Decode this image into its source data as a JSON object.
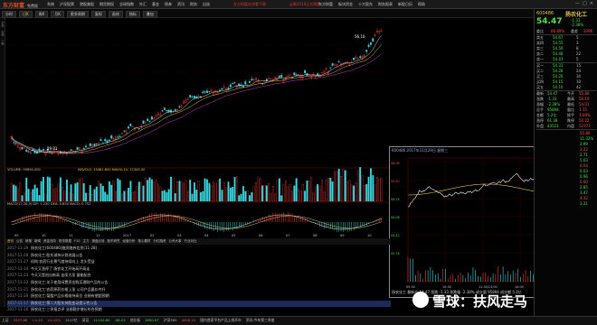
{
  "app": {
    "logo": "东方财富",
    "logo_sub": "免费版",
    "menu": [
      "系统",
      "沪深股票",
      "港股美股",
      "期货期权",
      "全球指数",
      "外汇",
      "基金",
      "债券",
      "资讯",
      "财务",
      "自选"
    ],
    "ad1": "东方财富在线看下载",
    "ad2": "云聚2018正式揭牌",
    "top_right": [
      "东方财富",
      "板块资金",
      "十大股东",
      "财务报表",
      "新股日历",
      "帮助"
    ],
    "win_controls": [
      "—",
      "□",
      "×"
    ]
  },
  "toolbar": {
    "tabs": [
      "分时",
      "日K",
      "周K",
      "月K",
      "更多周期",
      "复权",
      "画线",
      "指标",
      "叠加"
    ],
    "active_index": 1
  },
  "chart": {
    "title": "扬农化工 (日线 前复权)",
    "high_label": "56.10",
    "low_label": "29.01",
    "volume_label": "VOLUME: 95894.000",
    "volume_extra": "MAVOL5: 15481.600  MAVOL10: 12345.00",
    "macd_label": "MACD(12,26,9)  DIF: 1.230  DEA: 0.854  MACD: 0.752",
    "x_ticks": [
      "09",
      "10",
      "11",
      "12",
      "2017",
      "02",
      "03",
      "04",
      "05",
      "06",
      "07",
      "08",
      "09",
      "10"
    ],
    "left_labels": [
      "沪深",
      "行情",
      "个股"
    ]
  },
  "popup": {
    "title": "600486 2017年11月29日 星期三",
    "footer": "扬农化工 最新价 54.47 涨跌 -1.33 涨跌幅 -2.38% 成交量 95894 成交额 5.2亿",
    "y_labels_left": [
      "56.06",
      "55.40",
      "54.74",
      "54.08",
      "53.42",
      "52.76"
    ],
    "y_labels_right": [
      "4.59%",
      "3.00%",
      "1.71%",
      "0.31%",
      "-1.02%",
      "-2.38%"
    ],
    "x_labels": [
      "09:30",
      "10:30",
      "11:30/13:00",
      "14:00",
      "15:00"
    ]
  },
  "bottom": {
    "tabs": [
      "资讯",
      "公告",
      "研报",
      "新闻",
      "资金流向",
      "财务数据",
      "F10",
      "主力",
      "操盘必读",
      "股东研究",
      "经营分析",
      "核心题材",
      "分红融资",
      "公司大事",
      "行业对比"
    ],
    "active_index": 0
  },
  "news": [
    {
      "date": "2017-11-29",
      "title": "扬农化工(600486)融资融券信息(11-28)"
    },
    {
      "date": "2017-11-28",
      "title": "扬农化工:股东减持计划进展公告"
    },
    {
      "date": "2017-11-27",
      "title": "机构:农药行业景气度持续向上 龙头受益"
    },
    {
      "date": "2017-11-24",
      "title": "今天又涨停了 扬农化工开始高开高走"
    },
    {
      "date": "2017-11-23",
      "title": "今天又是创出新高 连续大涨 量能配合"
    },
    {
      "date": "2017-11-22",
      "title": "扬农化工:关于使用闲置资金购买理财产品的公告"
    },
    {
      "date": "2017-11-21",
      "title": "扬农化工:农药原药价格上涨 公司产品量价齐升"
    },
    {
      "date": "2017-11-20",
      "title": "扬农化工:菊酯产品价格维持高位 业绩有望超预期"
    },
    {
      "date": "2017-11-17",
      "title": "扬农化工:第二大股东持股变动提示性公告"
    },
    {
      "date": "2017-11-16",
      "title": "扬农化工:三季报点评 业绩稳步增长符合预期"
    }
  ],
  "news_selected_index": 8,
  "right_panel": {
    "code": "600486",
    "name": "扬农化工",
    "price": "54.47",
    "change": "-1.33",
    "change_pct": "-2.38%",
    "ratio_label": "委比",
    "ratio": "66.89%",
    "diff_label": "委差",
    "diff": "1096",
    "sell": [
      {
        "l": "卖五",
        "p": "54.67",
        "v": "5"
      },
      {
        "l": "卖四",
        "p": "54.55",
        "v": "3"
      },
      {
        "l": "卖三",
        "p": "54.50",
        "v": "8"
      },
      {
        "l": "卖二",
        "p": "54.48",
        "v": "22"
      },
      {
        "l": "卖一",
        "p": "54.47",
        "v": "5"
      }
    ],
    "buy": [
      {
        "l": "买一",
        "p": "54.31",
        "v": "15"
      },
      {
        "l": "买二",
        "p": "54.28",
        "v": "24"
      },
      {
        "l": "买三",
        "p": "54.20",
        "v": "34"
      },
      {
        "l": "买四",
        "p": "54.15",
        "v": "10"
      },
      {
        "l": "买五",
        "p": "54.10",
        "v": "42"
      }
    ],
    "stats": [
      {
        "l": "最新",
        "v": "54.47",
        "l2": "今开",
        "v2": "55.80"
      },
      {
        "l": "涨跌",
        "v": "-1.33",
        "l2": "最高",
        "v2": "56.10"
      },
      {
        "l": "涨幅",
        "v": "-2.38%",
        "l2": "最低",
        "v2": "54.01"
      },
      {
        "l": "总手",
        "v": "95894",
        "l2": "量比",
        "v2": "1.15"
      },
      {
        "l": "金额",
        "v": "5.2亿",
        "l2": "换手",
        "v2": "3.09%"
      },
      {
        "l": "涨停",
        "v": "61.38",
        "l2": "跌停",
        "v2": "50.22"
      },
      {
        "l": "外盘",
        "v": "43521",
        "l2": "内盘",
        "v2": "52373"
      }
    ],
    "side_values": [
      "55.80",
      "11.32%",
      "2.99",
      "3.22",
      "2.71",
      "5.03",
      "0.04",
      "0.03",
      "0.96",
      "0.00",
      "2.85",
      "3.47",
      "4.32",
      "3.21"
    ]
  },
  "status": [
    {
      "t": "上证",
      "c": ""
    },
    {
      "t": "3337.86",
      "c": "r"
    },
    {
      "t": "+4.13",
      "c": "r"
    },
    {
      "t": "+0.12%",
      "c": "r"
    },
    {
      "t": "2117亿",
      "c": ""
    },
    {
      "t": "深证",
      "c": ""
    },
    {
      "t": "11142.85",
      "c": "g"
    },
    {
      "t": "-58.23",
      "c": "g"
    },
    {
      "t": "创业板",
      "c": ""
    },
    {
      "t": "1850.07",
      "c": "g"
    },
    {
      "t": "沪深300",
      "c": ""
    },
    {
      "t": "4006.10",
      "c": "r"
    },
    {
      "t": "国内首家平台产品上线开市",
      "c": ""
    },
    {
      "t": "资讯:今年第三季度",
      "c": ""
    }
  ],
  "watermark": "雪球：扶风走马",
  "colors": {
    "up": "#ff4a4a",
    "down": "#4ce04c",
    "accent": "#e6c84a",
    "bg": "#000000"
  }
}
